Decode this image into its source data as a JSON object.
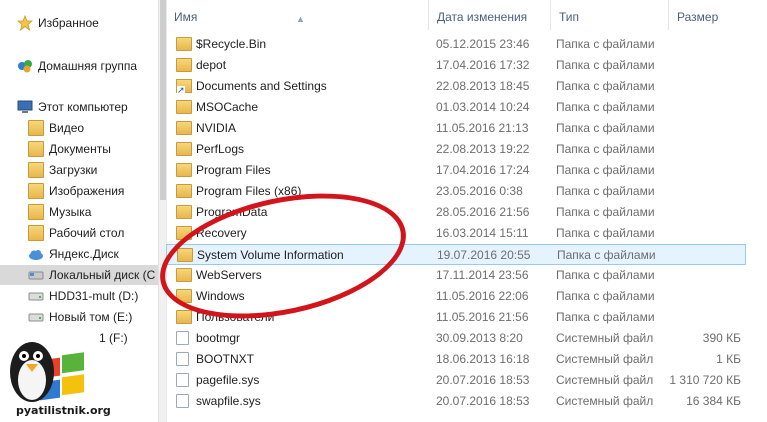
{
  "nav": {
    "items": [
      {
        "label": "Избранное",
        "icon": "star-icon"
      },
      {
        "label": "Домашняя группа",
        "icon": "homegroup-icon"
      },
      {
        "label": "Этот компьютер",
        "icon": "computer-icon"
      },
      {
        "label": "Видео",
        "icon": "video-folder-icon"
      },
      {
        "label": "Документы",
        "icon": "documents-folder-icon"
      },
      {
        "label": "Загрузки",
        "icon": "downloads-folder-icon"
      },
      {
        "label": "Изображения",
        "icon": "pictures-folder-icon"
      },
      {
        "label": "Музыка",
        "icon": "music-folder-icon"
      },
      {
        "label": "Рабочий стол",
        "icon": "desktop-folder-icon"
      },
      {
        "label": "Яндекс.Диск",
        "icon": "cloud-icon"
      },
      {
        "label": "Локальный диск (C",
        "icon": "local-disk-icon"
      },
      {
        "label": "HDD31-mult (D:)",
        "icon": "drive-icon"
      },
      {
        "label": "Новый том (E:)",
        "icon": "drive-icon"
      },
      {
        "label": "1 (F:)",
        "icon": "drive-icon"
      }
    ]
  },
  "columns": {
    "name": "Имя",
    "date": "Дата изменения",
    "type": "Тип",
    "size": "Размер"
  },
  "files": [
    {
      "name": "$Recycle.Bin",
      "date": "05.12.2015 23:46",
      "type": "Папка с файлами",
      "size": "",
      "kind": "folder"
    },
    {
      "name": "depot",
      "date": "17.04.2016 17:32",
      "type": "Папка с файлами",
      "size": "",
      "kind": "folder"
    },
    {
      "name": "Documents and Settings",
      "date": "22.08.2013 18:45",
      "type": "Папка с файлами",
      "size": "",
      "kind": "shortcut"
    },
    {
      "name": "MSOCache",
      "date": "01.03.2014 10:24",
      "type": "Папка с файлами",
      "size": "",
      "kind": "folder"
    },
    {
      "name": "NVIDIA",
      "date": "11.05.2016 21:13",
      "type": "Папка с файлами",
      "size": "",
      "kind": "folder"
    },
    {
      "name": "PerfLogs",
      "date": "22.08.2013 19:22",
      "type": "Папка с файлами",
      "size": "",
      "kind": "folder"
    },
    {
      "name": "Program Files",
      "date": "17.04.2016 17:24",
      "type": "Папка с файлами",
      "size": "",
      "kind": "folder"
    },
    {
      "name": "Program Files (x86)",
      "date": "23.05.2016 0:38",
      "type": "Папка с файлами",
      "size": "",
      "kind": "folder"
    },
    {
      "name": "ProgramData",
      "date": "28.05.2016 21:56",
      "type": "Папка с файлами",
      "size": "",
      "kind": "folder"
    },
    {
      "name": "Recovery",
      "date": "16.03.2014 15:11",
      "type": "Папка с файлами",
      "size": "",
      "kind": "folder"
    },
    {
      "name": "System Volume Information",
      "date": "19.07.2016 20:55",
      "type": "Папка с файлами",
      "size": "",
      "kind": "folder",
      "highlight": true
    },
    {
      "name": "WebServers",
      "date": "17.11.2014 23:56",
      "type": "Папка с файлами",
      "size": "",
      "kind": "folder"
    },
    {
      "name": "Windows",
      "date": "11.05.2016 22:06",
      "type": "Папка с файлами",
      "size": "",
      "kind": "folder"
    },
    {
      "name": "Пользователи",
      "date": "11.05.2016 21:56",
      "type": "Папка с файлами",
      "size": "",
      "kind": "folder"
    },
    {
      "name": "bootmgr",
      "date": "30.09.2013 8:20",
      "type": "Системный файл",
      "size": "390 КБ",
      "kind": "file"
    },
    {
      "name": "BOOTNXT",
      "date": "18.06.2013 16:18",
      "type": "Системный файл",
      "size": "1 КБ",
      "kind": "file"
    },
    {
      "name": "pagefile.sys",
      "date": "20.07.2016 18:53",
      "type": "Системный файл",
      "size": "1 310 720 КБ",
      "kind": "file"
    },
    {
      "name": "swapfile.sys",
      "date": "20.07.2016 18:53",
      "type": "Системный файл",
      "size": "16 384 КБ",
      "kind": "file"
    }
  ],
  "watermark": {
    "text": "pyatilistnik.org"
  },
  "colors": {
    "highlight_bg": "#e5f3ff",
    "highlight_border": "#99c9f0",
    "annotation_red": "#d2141b",
    "header_text": "#4c607a"
  }
}
